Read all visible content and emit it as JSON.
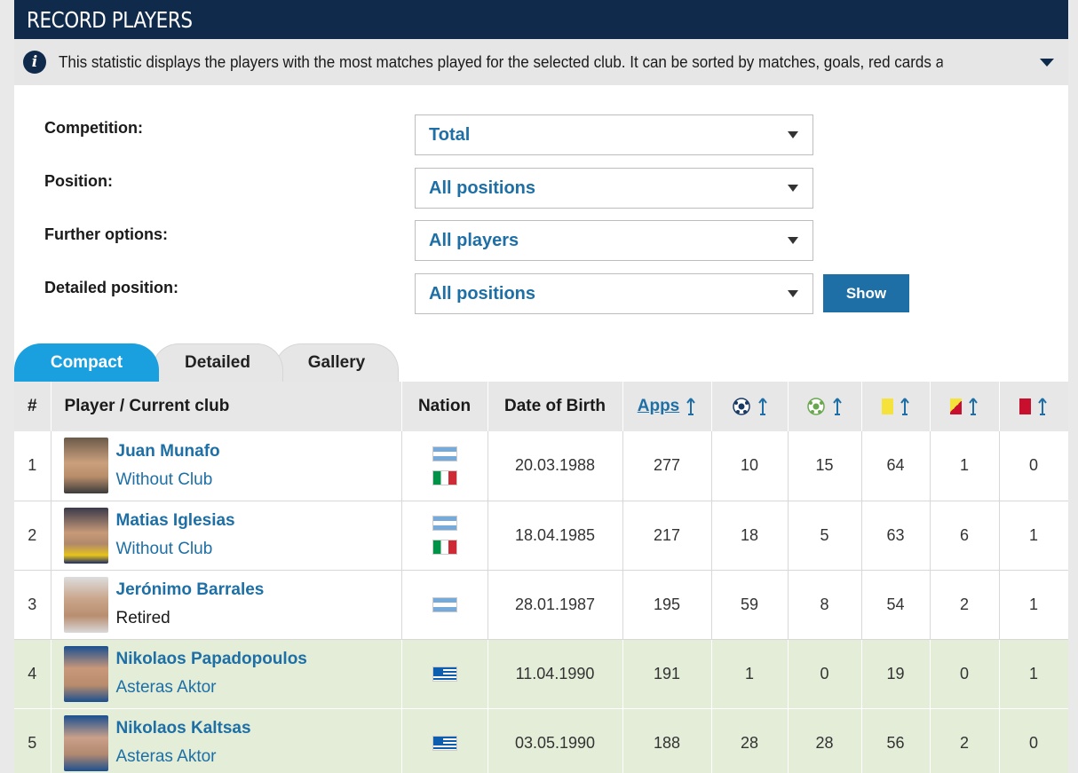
{
  "header": {
    "title": "RECORD PLAYERS"
  },
  "info": {
    "text": "This statistic displays the players with the most matches played for the selected club. It can be sorted by matches, goals, red cards and substi..."
  },
  "filters": {
    "competition_label": "Competition:",
    "competition_value": "Total",
    "position_label": "Position:",
    "position_value": "All positions",
    "further_label": "Further options:",
    "further_value": "All players",
    "detailed_label": "Detailed position:",
    "detailed_value": "All positions",
    "show_label": "Show"
  },
  "tabs": [
    {
      "label": "Compact"
    },
    {
      "label": "Detailed"
    },
    {
      "label": "Gallery"
    }
  ],
  "table": {
    "headers": {
      "rank": "#",
      "player": "Player / Current club",
      "nation": "Nation",
      "dob": "Date of Birth",
      "apps": "Apps"
    },
    "rows": [
      {
        "rank": "1",
        "name": "Juan Munafo",
        "club": "Without Club",
        "dob": "20.03.1988",
        "apps": "277",
        "goals": "10",
        "assists": "15",
        "yellow": "64",
        "second_yellow": "1",
        "red": "0"
      },
      {
        "rank": "2",
        "name": "Matias Iglesias",
        "club": "Without Club",
        "dob": "18.04.1985",
        "apps": "217",
        "goals": "18",
        "assists": "5",
        "yellow": "63",
        "second_yellow": "6",
        "red": "1"
      },
      {
        "rank": "3",
        "name": "Jerónimo Barrales",
        "club": "Retired",
        "dob": "28.01.1987",
        "apps": "195",
        "goals": "59",
        "assists": "8",
        "yellow": "54",
        "second_yellow": "2",
        "red": "1"
      },
      {
        "rank": "4",
        "name": "Nikolaos Papadopoulos",
        "club": "Asteras Aktor",
        "dob": "11.04.1990",
        "apps": "191",
        "goals": "1",
        "assists": "0",
        "yellow": "19",
        "second_yellow": "0",
        "red": "1"
      },
      {
        "rank": "5",
        "name": "Nikolaos Kaltsas",
        "club": "Asteras Aktor",
        "dob": "03.05.1990",
        "apps": "188",
        "goals": "28",
        "assists": "28",
        "yellow": "56",
        "second_yellow": "2",
        "red": "0"
      }
    ]
  },
  "colors": {
    "header_bg": "#0f2a4a",
    "accent_blue": "#1d6fa5",
    "active_tab": "#1a9fdf",
    "highlight_row": "#e3edd8"
  }
}
